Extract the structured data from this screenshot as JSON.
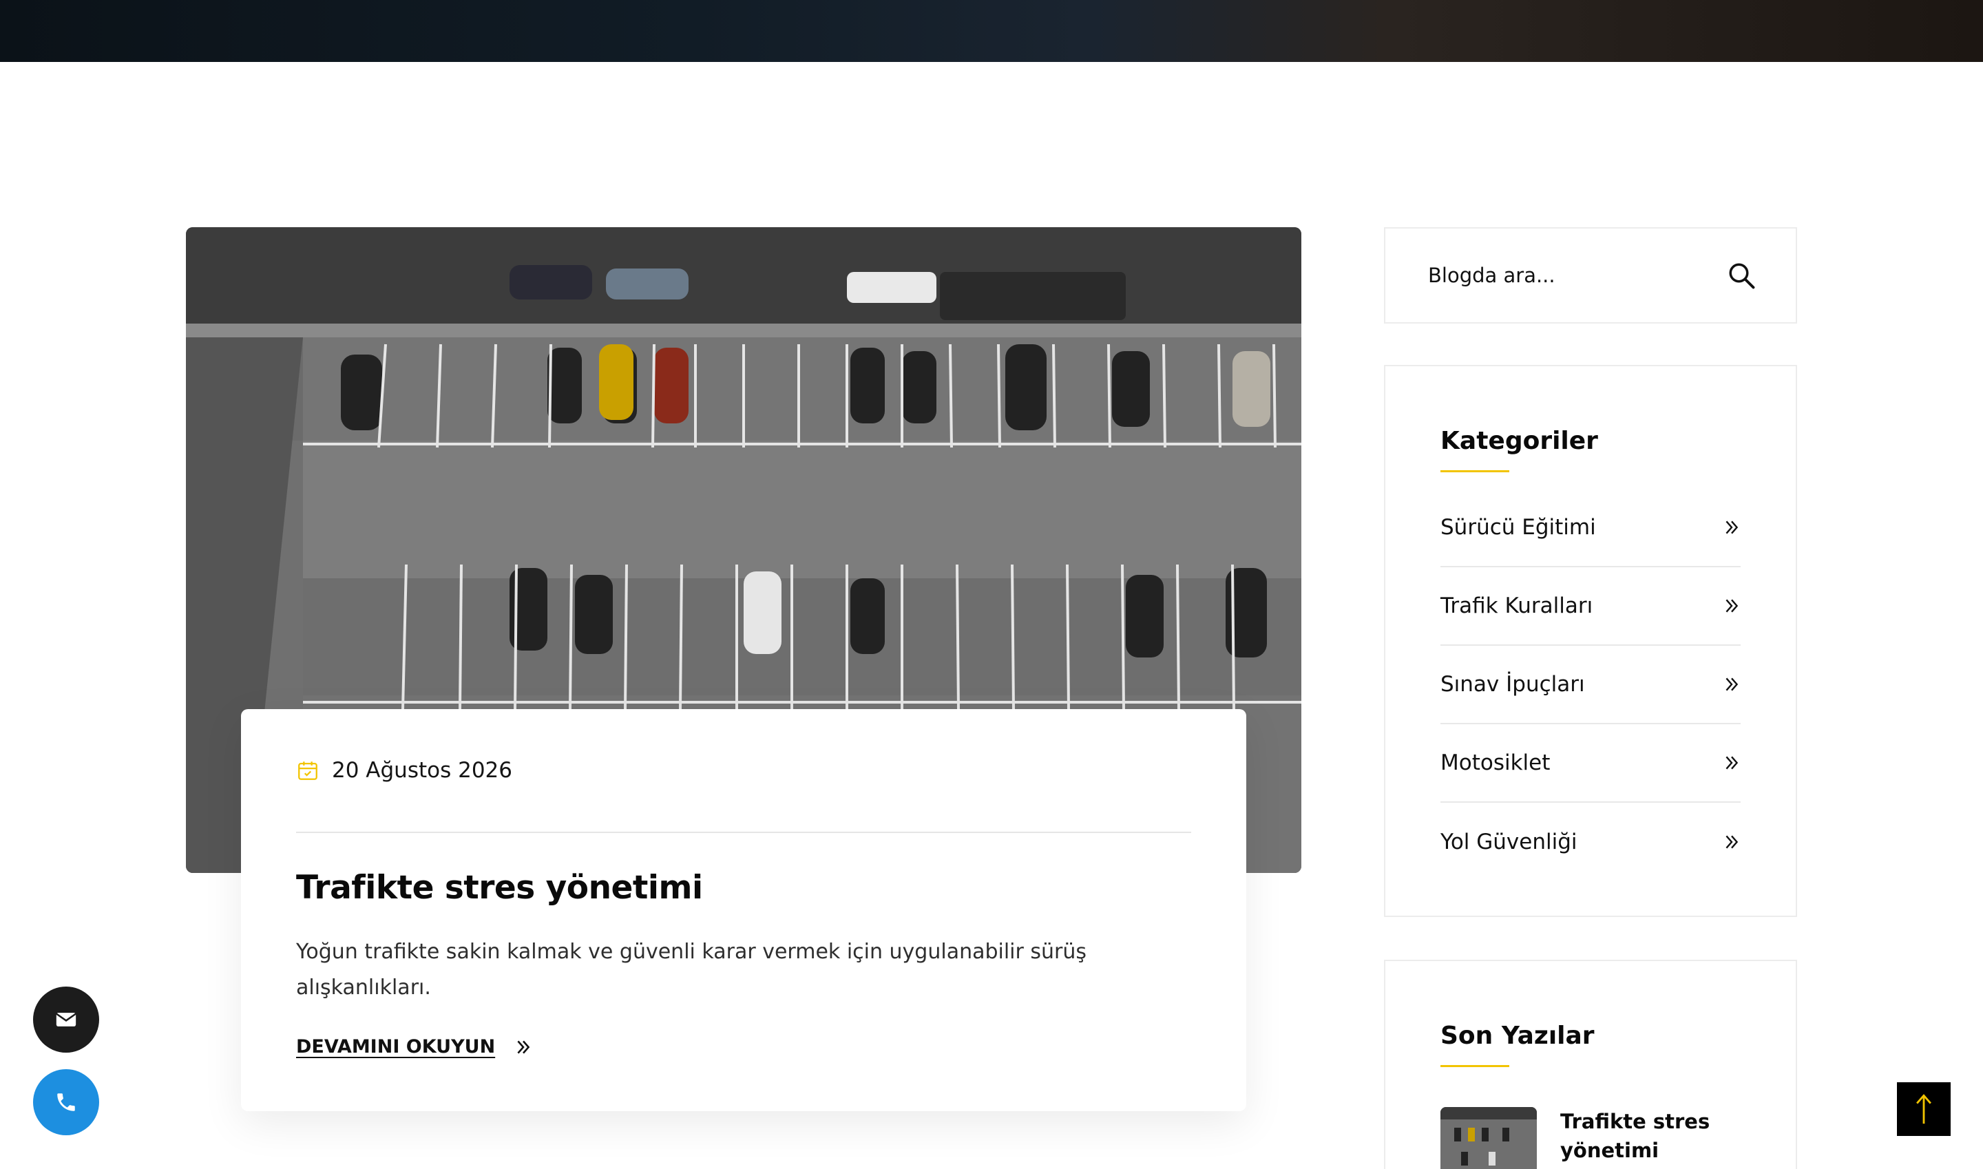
{
  "post": {
    "date": "20 Ağustos 2026",
    "title": "Trafikte stres yönetimi",
    "excerpt": "Yoğun trafikte sakin kalmak ve güvenli karar vermek için uygulanabilir sürüş alışkanlıkları.",
    "read_more": "DEVAMINI OKUYUN"
  },
  "sidebar": {
    "search": {
      "placeholder": "Blogda ara..."
    },
    "categories": {
      "title": "Kategoriler",
      "items": [
        {
          "label": "Sürücü Eğitimi"
        },
        {
          "label": "Trafik Kuralları"
        },
        {
          "label": "Sınav İpuçları"
        },
        {
          "label": "Motosiklet"
        },
        {
          "label": "Yol Güvenliği"
        }
      ]
    },
    "recent": {
      "title": "Son Yazılar",
      "items": [
        {
          "title": "Trafikte stres yönetimi"
        }
      ]
    }
  },
  "colors": {
    "accent": "#f2c400",
    "phone_button": "#1d8fe0",
    "mail_button": "#1c1c1c",
    "back_to_top": "#000000"
  },
  "icons": {
    "date": "calendar-icon",
    "read_more": "double-chevron-right-icon",
    "search": "search-icon",
    "category_arrow": "double-chevron-right-icon",
    "mail": "mail-icon",
    "phone": "phone-icon",
    "back_to_top": "arrow-up-icon"
  }
}
